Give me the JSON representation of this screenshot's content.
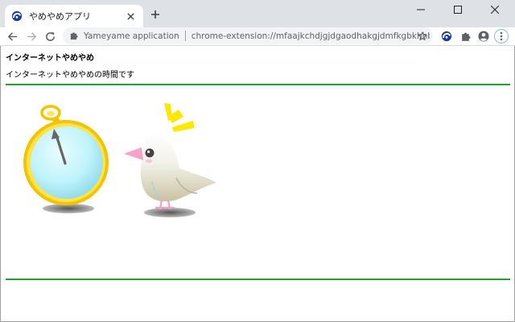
{
  "browser": {
    "tab": {
      "title": "やめやめアプリ",
      "favicon": "yameyame-app-icon"
    },
    "controls": {
      "close_tab_icon": "close-icon",
      "new_tab_icon": "plus-icon",
      "minimize_icon": "minimize-icon",
      "maximize_icon": "maximize-icon",
      "close_window_icon": "close-icon"
    },
    "toolbar": {
      "back_icon": "arrow-left-icon",
      "forward_icon": "arrow-right-icon",
      "reload_icon": "reload-icon",
      "site_icon": "puzzle-icon",
      "site_name": "Yameyame application",
      "url": "chrome-extension://mfaajkchdjgjdgaodhakgjdmfkgbkhhb/resources/index.html",
      "bookmark_icon": "star-icon",
      "extension_icon": "yameyame-app-icon",
      "extensions_menu_icon": "puzzle-icon",
      "profile_icon": "account-icon",
      "menu_icon": "more-vertical-icon"
    }
  },
  "page": {
    "heading": "インターネットやめやめ",
    "message": "インターネットやめやめの時間です",
    "illustration_icons": [
      "stopwatch-icon",
      "java-sparrow-bird-icon"
    ]
  },
  "colors": {
    "tab_strip": "#dee1e6",
    "omnibox": "#f1f3f4",
    "rule": "#22a02a",
    "stopwatch_gold": "#f5c400",
    "stopwatch_face": "#bff3fb"
  }
}
